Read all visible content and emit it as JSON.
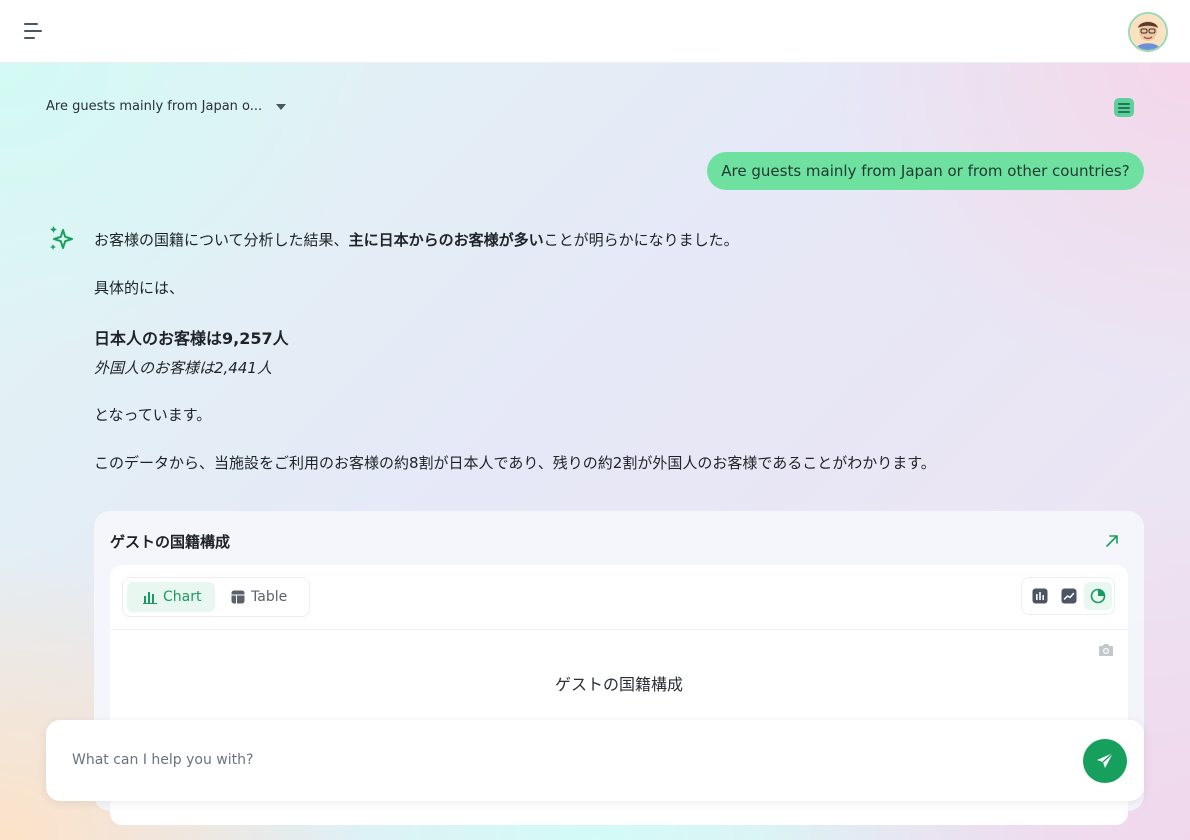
{
  "header": {
    "menu_icon": "hamburger-menu-icon",
    "avatar_icon": "user-avatar"
  },
  "conversation": {
    "title": "Are guests mainly from Japan o...",
    "list_icon": "list-icon"
  },
  "user_message": "Are guests mainly from Japan or from other countries?",
  "assistant": {
    "icon": "sparkle-icon",
    "line1_pre": "お客様の国籍について分析した結果、",
    "line1_bold": "主に日本からのお客様が多い",
    "line1_post": "ことが明らかになりました。",
    "line2": "具体的には、",
    "line3": "日本人のお客様は9,257人",
    "line4": "外国人のお客様は2,441人",
    "line5": "となっています。",
    "line6": "このデータから、当施設をご利用のお客様の約8割が日本人であり、残りの約2割が外国人のお客様であることがわかります。"
  },
  "card": {
    "title": "ゲストの国籍構成",
    "tabs": [
      {
        "label": "Chart",
        "icon": "bar-chart-icon",
        "active": true
      },
      {
        "label": "Table",
        "icon": "table-icon",
        "active": false
      }
    ],
    "chart_types": [
      "bar-chart-icon",
      "line-chart-icon",
      "pie-chart-icon"
    ],
    "active_chart_type": "pie-chart-icon",
    "camera_icon": "camera-icon",
    "chart_title": "ゲストの国籍構成"
  },
  "composer": {
    "placeholder": "What can I help you with?",
    "value": "",
    "send_icon": "send-icon"
  },
  "colors": {
    "accent": "#17a05d",
    "user_bubble": "#6ee0a0",
    "tab_active_bg": "#e8f7ef"
  }
}
